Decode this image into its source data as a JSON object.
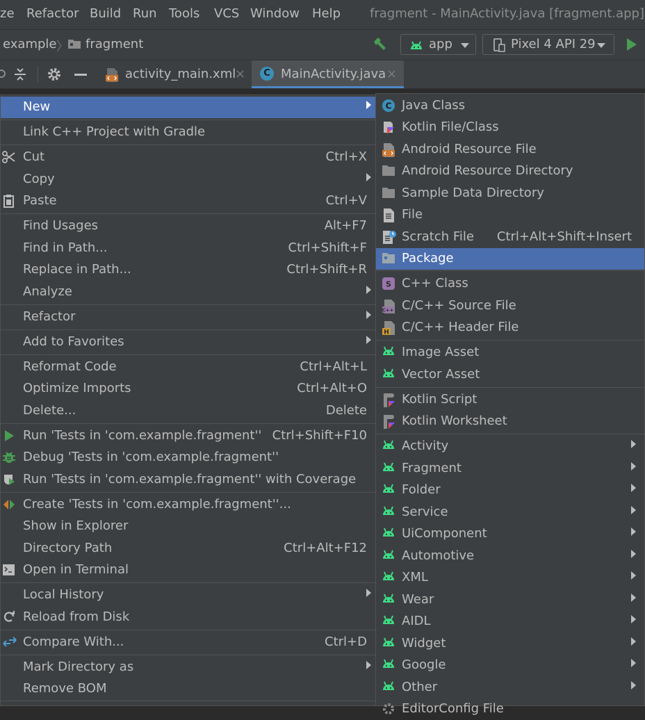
{
  "menubar": {
    "items": [
      "ze",
      "Refactor",
      "Build",
      "Run",
      "Tools",
      "VCS",
      "Window",
      "Help"
    ],
    "window_title": "fragment - MainActivity.java [fragment.app] - A"
  },
  "navbar": {
    "crumb_example": "example",
    "crumb_fragment": "fragment",
    "config": "app",
    "device": "Pixel 4 API 29"
  },
  "tabs": [
    {
      "label": "activity_main.xml",
      "close": "×"
    },
    {
      "label": "MainActivity.java",
      "close": "×"
    }
  ],
  "context_menu": {
    "items": [
      {
        "label": "New",
        "shortcut": "",
        "arrow": true,
        "selected": true,
        "icon": ""
      },
      {
        "label": "Link C++ Project with Gradle",
        "shortcut": "",
        "icon": ""
      },
      {
        "label": "Cut",
        "shortcut": "Ctrl+X",
        "icon": "scissors-icon"
      },
      {
        "label": "Copy",
        "shortcut": "",
        "arrow": true,
        "icon": ""
      },
      {
        "label": "Paste",
        "shortcut": "Ctrl+V",
        "icon": "clipboard-icon"
      },
      {
        "label": "Find Usages",
        "shortcut": "Alt+F7",
        "icon": ""
      },
      {
        "label": "Find in Path...",
        "shortcut": "Ctrl+Shift+F",
        "icon": ""
      },
      {
        "label": "Replace in Path...",
        "shortcut": "Ctrl+Shift+R",
        "icon": ""
      },
      {
        "label": "Analyze",
        "shortcut": "",
        "arrow": true,
        "icon": ""
      },
      {
        "label": "Refactor",
        "shortcut": "",
        "arrow": true,
        "icon": ""
      },
      {
        "label": "Add to Favorites",
        "shortcut": "",
        "arrow": true,
        "icon": ""
      },
      {
        "label": "Reformat Code",
        "shortcut": "Ctrl+Alt+L",
        "icon": ""
      },
      {
        "label": "Optimize Imports",
        "shortcut": "Ctrl+Alt+O",
        "icon": ""
      },
      {
        "label": "Delete...",
        "shortcut": "Delete",
        "icon": ""
      },
      {
        "label": "Run 'Tests in 'com.example.fragment''",
        "shortcut": "Ctrl+Shift+F10",
        "icon": "run-icon"
      },
      {
        "label": "Debug 'Tests in 'com.example.fragment''",
        "shortcut": "",
        "icon": "debug-icon"
      },
      {
        "label": "Run 'Tests in 'com.example.fragment'' with Coverage",
        "shortcut": "",
        "icon": "coverage-icon"
      },
      {
        "label": "Create 'Tests in 'com.example.fragment''...",
        "shortcut": "",
        "icon": "create-test-icon"
      },
      {
        "label": "Show in Explorer",
        "shortcut": "",
        "icon": ""
      },
      {
        "label": "Directory Path",
        "shortcut": "Ctrl+Alt+F12",
        "icon": ""
      },
      {
        "label": "Open in Terminal",
        "shortcut": "",
        "icon": "terminal-icon"
      },
      {
        "label": "Local History",
        "shortcut": "",
        "arrow": true,
        "icon": ""
      },
      {
        "label": "Reload from Disk",
        "shortcut": "",
        "icon": "reload-icon"
      },
      {
        "label": "Compare With...",
        "shortcut": "Ctrl+D",
        "icon": "compare-icon"
      },
      {
        "label": "Mark Directory as",
        "shortcut": "",
        "arrow": true,
        "icon": ""
      },
      {
        "label": "Remove BOM",
        "shortcut": "",
        "icon": ""
      }
    ]
  },
  "new_submenu": {
    "items": [
      {
        "label": "Java Class",
        "shortcut": "",
        "icon": "java-class-icon"
      },
      {
        "label": "Kotlin File/Class",
        "shortcut": "",
        "icon": "kotlin-icon"
      },
      {
        "label": "Android Resource File",
        "shortcut": "",
        "icon": "android-resource-file-icon"
      },
      {
        "label": "Android Resource Directory",
        "shortcut": "",
        "icon": "folder-icon"
      },
      {
        "label": "Sample Data Directory",
        "shortcut": "",
        "icon": "folder-icon"
      },
      {
        "label": "File",
        "shortcut": "",
        "icon": "file-icon"
      },
      {
        "label": "Scratch File",
        "shortcut": "Ctrl+Alt+Shift+Insert",
        "icon": "scratch-file-icon"
      },
      {
        "label": "Package",
        "shortcut": "",
        "selected": true,
        "icon": "package-icon"
      },
      {
        "label": "C++ Class",
        "shortcut": "",
        "icon": "cpp-class-icon"
      },
      {
        "label": "C/C++ Source File",
        "shortcut": "",
        "icon": "cpp-source-icon"
      },
      {
        "label": "C/C++ Header File",
        "shortcut": "",
        "icon": "cpp-header-icon"
      },
      {
        "label": "Image Asset",
        "shortcut": "",
        "icon": "android-icon"
      },
      {
        "label": "Vector Asset",
        "shortcut": "",
        "icon": "android-icon"
      },
      {
        "label": "Kotlin Script",
        "shortcut": "",
        "icon": "kotlin-script-icon"
      },
      {
        "label": "Kotlin Worksheet",
        "shortcut": "",
        "icon": "kotlin-script-icon"
      },
      {
        "label": "Activity",
        "shortcut": "",
        "arrow": true,
        "icon": "android-icon"
      },
      {
        "label": "Fragment",
        "shortcut": "",
        "arrow": true,
        "icon": "android-icon"
      },
      {
        "label": "Folder",
        "shortcut": "",
        "arrow": true,
        "icon": "android-icon"
      },
      {
        "label": "Service",
        "shortcut": "",
        "arrow": true,
        "icon": "android-icon"
      },
      {
        "label": "UiComponent",
        "shortcut": "",
        "arrow": true,
        "icon": "android-icon"
      },
      {
        "label": "Automotive",
        "shortcut": "",
        "arrow": true,
        "icon": "android-icon"
      },
      {
        "label": "XML",
        "shortcut": "",
        "arrow": true,
        "icon": "android-icon"
      },
      {
        "label": "Wear",
        "shortcut": "",
        "arrow": true,
        "icon": "android-icon"
      },
      {
        "label": "AIDL",
        "shortcut": "",
        "arrow": true,
        "icon": "android-icon"
      },
      {
        "label": "Widget",
        "shortcut": "",
        "arrow": true,
        "icon": "android-icon"
      },
      {
        "label": "Google",
        "shortcut": "",
        "arrow": true,
        "icon": "android-icon"
      },
      {
        "label": "Other",
        "shortcut": "",
        "arrow": true,
        "icon": "android-icon"
      },
      {
        "label": "EditorConfig File",
        "shortcut": "",
        "icon": "gear-icon"
      }
    ]
  },
  "colors": {
    "background": "#2b2b2b",
    "panel": "#3c3f41",
    "selection": "#4b6eaf",
    "text": "#bbbbbb",
    "android_green": "#3ddc84",
    "run_green": "#499c54"
  }
}
